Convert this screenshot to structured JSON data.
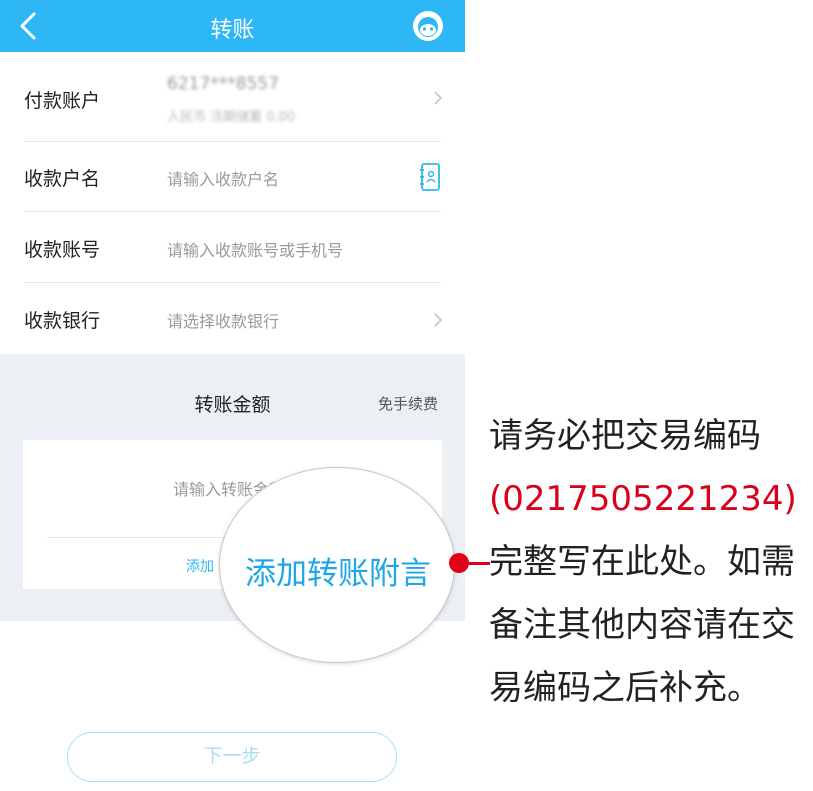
{
  "header": {
    "title": "转账",
    "back_icon": "chevron-left-icon",
    "service_icon": "customer-service-icon",
    "bg_color": "#2db7f5"
  },
  "form": {
    "payer": {
      "label": "付款账户",
      "account_number": "6217***8557",
      "balance_text": "人民币 活期储蓄 0.00"
    },
    "payee_name": {
      "label": "收款户名",
      "placeholder": "请输入收款户名",
      "icon": "contact-book-icon"
    },
    "payee_account": {
      "label": "收款账号",
      "placeholder": "请输入收款账号或手机号"
    },
    "payee_bank": {
      "label": "收款银行",
      "placeholder": "请选择收款银行"
    }
  },
  "amount": {
    "title": "转账金额",
    "fee_note": "免手续费",
    "placeholder": "请输入转账金额",
    "add_note_link": "添加"
  },
  "magnifier": {
    "text": "添加转账附言"
  },
  "next_button": {
    "label": "下一步"
  },
  "annotation": {
    "part1": "请务必把交易编码",
    "code": "(0217505221234)",
    "part2": "完整写在此处。如需备注其他内容请在交易编码之后补充。",
    "accent_color": "#d8001a"
  }
}
